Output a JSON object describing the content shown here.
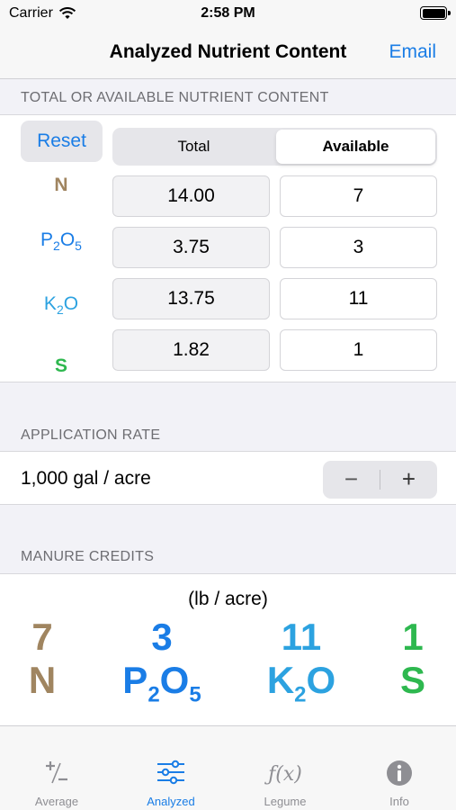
{
  "status_bar": {
    "carrier": "Carrier",
    "time": "2:58 PM"
  },
  "nav": {
    "title": "Analyzed Nutrient Content",
    "email": "Email"
  },
  "nutrient_section": {
    "header": "TOTAL OR AVAILABLE NUTRIENT CONTENT",
    "reset": "Reset",
    "segments": {
      "total": "Total",
      "available": "Available",
      "selected": "Available"
    },
    "rows": [
      {
        "label": "N",
        "sub": "",
        "label_end": "",
        "total": "14.00",
        "available": "7"
      },
      {
        "label": "P",
        "sub": "2",
        "label_end": "O",
        "sub2": "5",
        "total": "3.75",
        "available": "3"
      },
      {
        "label": "K",
        "sub": "2",
        "label_end": "O",
        "sub2": "",
        "total": "13.75",
        "available": "11"
      },
      {
        "label": "S",
        "sub": "",
        "label_end": "",
        "total": "1.82",
        "available": "1"
      }
    ]
  },
  "application_rate": {
    "header": "APPLICATION RATE",
    "value": "1,000 gal / acre",
    "minus": "−",
    "plus": "+"
  },
  "manure_credits": {
    "header": "MANURE CREDITS",
    "unit": "(lb / acre)",
    "items": [
      {
        "value": "7",
        "symbol": "N",
        "color": "#a08560"
      },
      {
        "value": "3",
        "symbol": "P",
        "color": "#1a7de6"
      },
      {
        "value": "11",
        "symbol": "K",
        "color": "#2ca2e0"
      },
      {
        "value": "1",
        "symbol": "S",
        "color": "#2eb84f"
      }
    ]
  },
  "tabs": [
    {
      "label": "Average",
      "icon": "plus-minus-icon"
    },
    {
      "label": "Analyzed",
      "icon": "sliders-icon",
      "active": true
    },
    {
      "label": "Legume",
      "icon": "function-icon"
    },
    {
      "label": "Info",
      "icon": "info-icon"
    }
  ],
  "colors": {
    "accent": "#1a7de6",
    "nitrogen": "#a08560",
    "phosphate": "#1a7de6",
    "potash": "#2ca2e0",
    "sulfur": "#2eb84f"
  }
}
